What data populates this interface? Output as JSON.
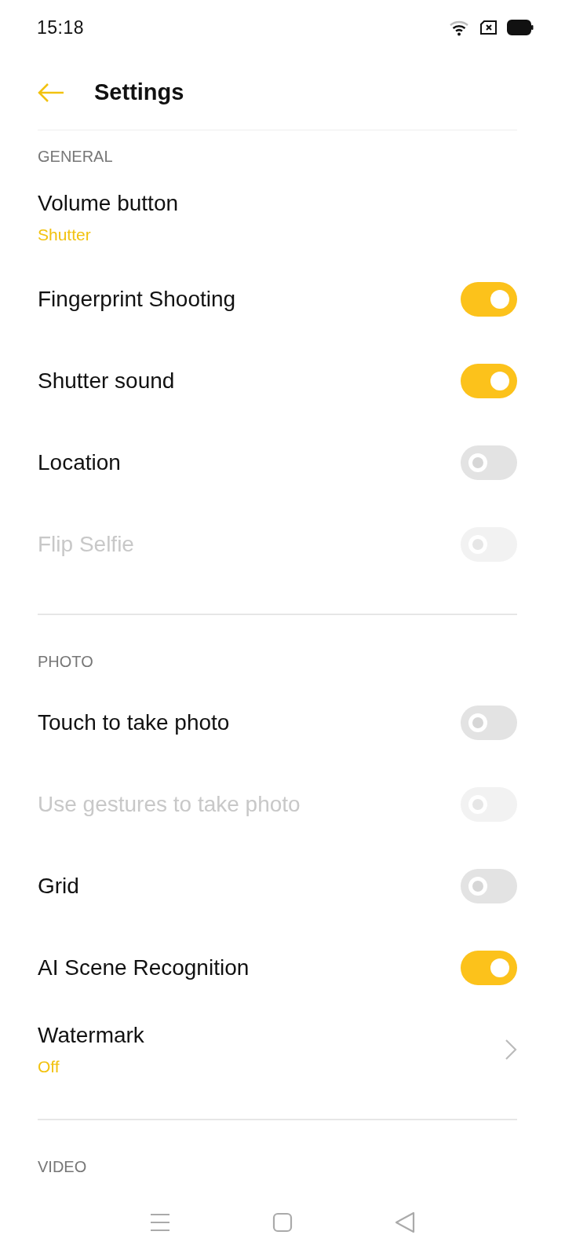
{
  "status_bar": {
    "time": "15:18"
  },
  "header": {
    "title": "Settings"
  },
  "sections": [
    {
      "title": "GENERAL",
      "items": [
        {
          "kind": "value",
          "label": "Volume button",
          "value": "Shutter",
          "disabled": false
        },
        {
          "kind": "toggle",
          "label": "Fingerprint Shooting",
          "on": true,
          "disabled": false
        },
        {
          "kind": "toggle",
          "label": "Shutter sound",
          "on": true,
          "disabled": false
        },
        {
          "kind": "toggle",
          "label": "Location",
          "on": false,
          "disabled": false
        },
        {
          "kind": "toggle",
          "label": "Flip Selfie",
          "on": false,
          "disabled": true
        }
      ]
    },
    {
      "title": "PHOTO",
      "items": [
        {
          "kind": "toggle",
          "label": "Touch to take photo",
          "on": false,
          "disabled": false
        },
        {
          "kind": "toggle",
          "label": "Use gestures to take photo",
          "on": false,
          "disabled": true
        },
        {
          "kind": "toggle",
          "label": "Grid",
          "on": false,
          "disabled": false
        },
        {
          "kind": "toggle",
          "label": "AI Scene Recognition",
          "on": true,
          "disabled": false
        },
        {
          "kind": "link",
          "label": "Watermark",
          "value": "Off",
          "disabled": false
        }
      ]
    },
    {
      "title": "VIDEO"
    }
  ]
}
